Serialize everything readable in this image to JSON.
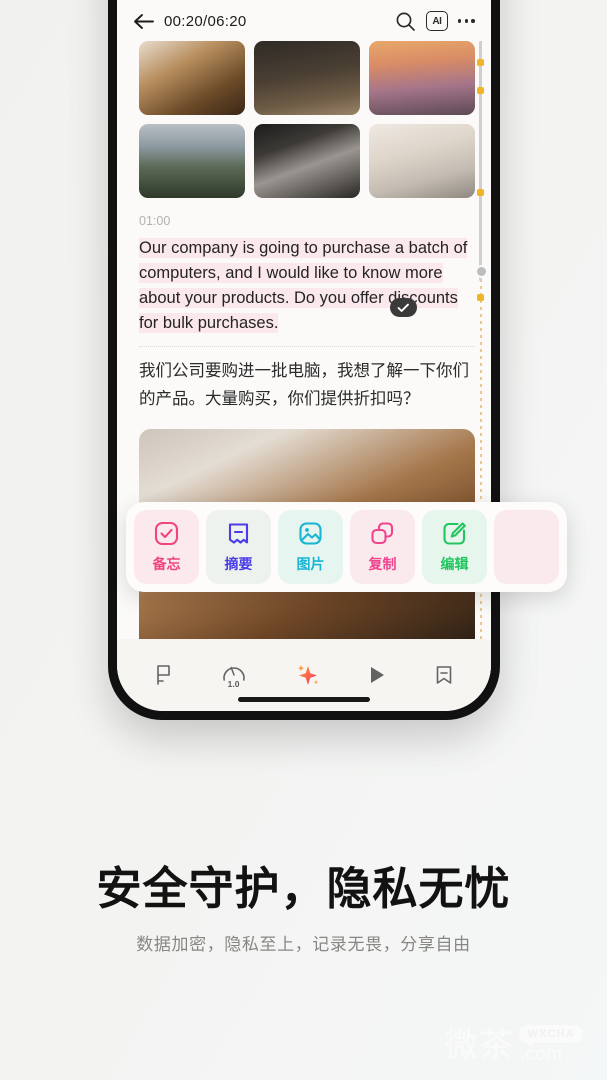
{
  "phone": {
    "topbar": {
      "back_icon": "back-arrow-icon",
      "time": "00:20/06:20",
      "search_icon": "search-icon",
      "ai_label": "AI",
      "more_icon": "more-options-icon"
    },
    "gallery": {
      "photos": [
        {
          "alt": "coffee maker on wooden table"
        },
        {
          "alt": "dark mountain landscape"
        },
        {
          "alt": "sunset over beach"
        },
        {
          "alt": "white car in mountains"
        },
        {
          "alt": "person in car window"
        },
        {
          "alt": "monitor and speaker on desk"
        }
      ]
    },
    "transcript": {
      "timestamp": "01:00",
      "english": "Our company is going to purchase a batch of computers, and I would like to know more about your products. Do you offer discounts for bulk purchases.",
      "chinese": "我们公司要购进一批电脑，我想了解一下你们的产品。大量购买，你们提供折扣吗？",
      "badge_icon": "check-badge-icon"
    },
    "large_photo": {
      "alt": "coffee press on wooden table"
    },
    "action_bar": {
      "items": [
        {
          "label": "备忘",
          "icon": "check-square-icon",
          "color": "#f0457e",
          "bg": "#fce9ee"
        },
        {
          "label": "摘要",
          "icon": "summary-bookmark-icon",
          "color": "#4a3de8",
          "bg": "#eef2ee"
        },
        {
          "label": "图片",
          "icon": "image-icon",
          "color": "#19b5d4",
          "bg": "#e6f5ef"
        },
        {
          "label": "复制",
          "icon": "copy-icon",
          "color": "#f0458e",
          "bg": "#fbeaed"
        },
        {
          "label": "编辑",
          "icon": "edit-pencil-icon",
          "color": "#22c55e",
          "bg": "#e6f6ec"
        },
        {
          "label": "",
          "icon": "overflow-icon",
          "color": "#f0458e",
          "bg": "#fbeaed"
        }
      ]
    },
    "bottombar": {
      "items": [
        {
          "icon": "flag-icon",
          "label": ""
        },
        {
          "icon": "speed-gauge-icon",
          "label": "1.0"
        },
        {
          "icon": "ai-sparkle-icon",
          "label": ""
        },
        {
          "icon": "play-icon",
          "label": ""
        },
        {
          "icon": "bookmark-icon",
          "label": ""
        }
      ]
    }
  },
  "marketing": {
    "headline": "安全守护，隐私无忧",
    "subline": "数据加密，隐私至上，记录无畏，分享自由"
  },
  "watermark": {
    "cn": "微茶",
    "bubble": "WXCHA",
    "domain": ".com"
  }
}
